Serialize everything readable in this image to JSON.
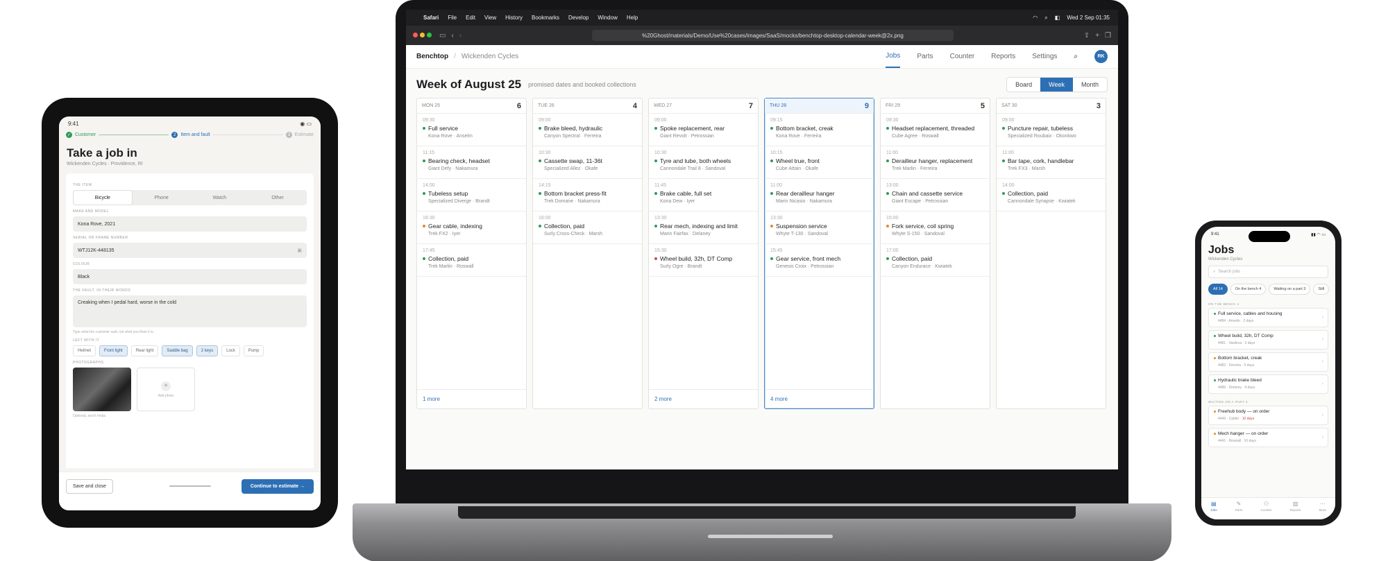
{
  "tablet": {
    "status": {
      "time": "9:41"
    },
    "steps": [
      {
        "label": "Customer",
        "marker": "✓",
        "color": "#2f9a5a"
      },
      {
        "label": "Item and fault",
        "marker": "2",
        "color": "#2d6fb4"
      },
      {
        "label": "Estimate",
        "marker": "3",
        "color": "#bbbbbb"
      }
    ],
    "title": "Take a job in",
    "subtitle": "Wickenden Cycles · Providence, RI",
    "item_label": "THE ITEM",
    "item_types": [
      "Bicycle",
      "Phone",
      "Watch",
      "Other"
    ],
    "make_label": "MAKE AND MODEL",
    "make_value": "Kona Rove, 2021",
    "serial_label": "SERIAL OR FRAME NUMBER",
    "serial_value": "WTJ12K-448135",
    "colour_label": "COLOUR",
    "colour_value": "Black",
    "fault_label": "THE FAULT, IN THEIR WORDS",
    "fault_value": "Creaking when I pedal hard, worse in the cold",
    "fault_hint": "Type what the customer said, not what you think it is.",
    "left_label": "LEFT WITH IT",
    "left_items": [
      {
        "label": "Helmet",
        "on": false
      },
      {
        "label": "Front light",
        "on": true
      },
      {
        "label": "Rear light",
        "on": false
      },
      {
        "label": "Saddle bag",
        "on": true
      },
      {
        "label": "2 keys",
        "on": true
      },
      {
        "label": "Lock",
        "on": false
      },
      {
        "label": "Pump",
        "on": false
      }
    ],
    "photos_label": "PHOTOGRAPHS",
    "add_photo": "Add photo",
    "photos_hint": "Optional, and it helps.",
    "save_button": "Save and close",
    "continue_button": "Continue to estimate →"
  },
  "laptop": {
    "menubar": {
      "app": "Safari",
      "items": [
        "File",
        "Edit",
        "View",
        "History",
        "Bookmarks",
        "Develop",
        "Window",
        "Help"
      ],
      "datetime": "Wed 2 Sep  01:35"
    },
    "url": "%20Ghost/materials/Demo/Use%20cases/images/SaaS/mocks/benchtop-desktop-calendar-week@2x.png",
    "brand": "Benchtop",
    "org": "Wickenden Cycles",
    "nav_tabs": [
      "Jobs",
      "Parts",
      "Counter",
      "Reports",
      "Settings"
    ],
    "active_tab": "Jobs",
    "avatar": "RK",
    "week_title": "Week of August 25",
    "week_sub": "promised dates and booked collections",
    "views": [
      "Board",
      "Week",
      "Month"
    ],
    "active_view": "Week",
    "days": [
      {
        "label": "MON 25",
        "count": "6",
        "today": false,
        "more": "1 more",
        "jobs": [
          {
            "time": "09:30",
            "title": "Full service",
            "meta": "Kona Rove · Anselm",
            "color": "#2f9a5a"
          },
          {
            "time": "11:15",
            "title": "Bearing check, headset",
            "meta": "Giant Defy · Nakamura",
            "color": "#2f9a5a"
          },
          {
            "time": "14:00",
            "title": "Tubeless setup",
            "meta": "Specialized Diverge · Brandt",
            "color": "#2f9a5a"
          },
          {
            "time": "16:30",
            "title": "Gear cable, indexing",
            "meta": "Trek FX2 · Iyer",
            "color": "#e08a2c"
          },
          {
            "time": "17:45",
            "title": "Collection, paid",
            "meta": "Trek Marlin · Roswall",
            "color": "#2f9a5a"
          }
        ]
      },
      {
        "label": "TUE 26",
        "count": "4",
        "today": false,
        "more": "",
        "jobs": [
          {
            "time": "09:00",
            "title": "Brake bleed, hydraulic",
            "meta": "Canyon Spectral · Ferreira",
            "color": "#2f9a5a"
          },
          {
            "time": "10:30",
            "title": "Cassette swap, 11-36t",
            "meta": "Specialized Allez · Okafe",
            "color": "#2f9a5a"
          },
          {
            "time": "14:15",
            "title": "Bottom bracket press-fit",
            "meta": "Trek Domane · Nakamura",
            "color": "#2f9a5a"
          },
          {
            "time": "16:00",
            "title": "Collection, paid",
            "meta": "Surly Cross-Check · Marsh",
            "color": "#2f9a5a"
          }
        ]
      },
      {
        "label": "WED 27",
        "count": "7",
        "today": false,
        "more": "2 more",
        "jobs": [
          {
            "time": "09:00",
            "title": "Spoke replacement, rear",
            "meta": "Giant Revolt · Petrossian",
            "color": "#2f9a5a"
          },
          {
            "time": "10:30",
            "title": "Tyre and tube, both wheels",
            "meta": "Cannondale Trail 8 · Sandoval",
            "color": "#2f9a5a"
          },
          {
            "time": "11:45",
            "title": "Brake cable, full set",
            "meta": "Kona Dew · Iyer",
            "color": "#2f9a5a"
          },
          {
            "time": "13:30",
            "title": "Rear mech, indexing and limit",
            "meta": "Marin Fairfax · Delaney",
            "color": "#2f9a5a"
          },
          {
            "time": "15:30",
            "title": "Wheel build, 32h, DT Comp",
            "meta": "Surly Ogre · Brandt",
            "color": "#c0504d"
          }
        ]
      },
      {
        "label": "THU 28",
        "count": "9",
        "today": true,
        "more": "4 more",
        "jobs": [
          {
            "time": "09:15",
            "title": "Bottom bracket, creak",
            "meta": "Kona Rove · Ferreira",
            "color": "#2f9a5a"
          },
          {
            "time": "10:15",
            "title": "Wheel true, front",
            "meta": "Cube Attain · Okafe",
            "color": "#2f9a5a"
          },
          {
            "time": "11:00",
            "title": "Rear derailleur hanger",
            "meta": "Marin Nicasio · Nakamura",
            "color": "#2f9a5a"
          },
          {
            "time": "13:30",
            "title": "Suspension service",
            "meta": "Whyte T-130 · Sandoval",
            "color": "#e08a2c"
          },
          {
            "time": "15:45",
            "title": "Gear service, front mech",
            "meta": "Genesis Croix · Petrossian",
            "color": "#2f9a5a"
          }
        ]
      },
      {
        "label": "FRI 29",
        "count": "5",
        "today": false,
        "more": "",
        "jobs": [
          {
            "time": "09:30",
            "title": "Headset replacement, threaded",
            "meta": "Cube Agree · Roswall",
            "color": "#2f9a5a"
          },
          {
            "time": "11:00",
            "title": "Derailleur hanger, replacement",
            "meta": "Trek Marlin · Ferreira",
            "color": "#2f9a5a"
          },
          {
            "time": "13:00",
            "title": "Chain and cassette service",
            "meta": "Giant Escape · Petrossian",
            "color": "#2f9a5a"
          },
          {
            "time": "15:00",
            "title": "Fork service, coil spring",
            "meta": "Whyte S-150 · Sandoval",
            "color": "#e08a2c"
          },
          {
            "time": "17:00",
            "title": "Collection, paid",
            "meta": "Canyon Endurace · Kwiatek",
            "color": "#2f9a5a"
          }
        ]
      },
      {
        "label": "SAT 30",
        "count": "3",
        "today": false,
        "more": "",
        "jobs": [
          {
            "time": "09:00",
            "title": "Puncture repair, tubeless",
            "meta": "Specialized Roubaix · Okonkwo",
            "color": "#2f9a5a"
          },
          {
            "time": "11:00",
            "title": "Bar tape, cork, handlebar",
            "meta": "Trek FX3 · Marsh",
            "color": "#2f9a5a"
          },
          {
            "time": "14:00",
            "title": "Collection, paid",
            "meta": "Cannondale Synapse · Kwiatek",
            "color": "#2f9a5a"
          }
        ]
      }
    ]
  },
  "phone": {
    "title": "Jobs",
    "subtitle": "Wickenden Cycles",
    "search_placeholder": "Search jobs",
    "filters": [
      "All 14",
      "On the bench 4",
      "Waiting on a part 3",
      "Still"
    ],
    "sections": [
      {
        "label": "ON THE BENCH 4",
        "items": [
          {
            "name": "Full service, cables and housing",
            "meta": "4484 · Anselm · 2 days",
            "late": "",
            "color": "#2f9a5a"
          },
          {
            "name": "Wheel build, 32h, DT Comp",
            "meta": "4481 · Vasileva · 3 days",
            "late": "",
            "color": "#2f9a5a"
          },
          {
            "name": "Bottom bracket, creak",
            "meta": "4482 · Ferreira · 5 days",
            "late": "",
            "color": "#e08a2c"
          },
          {
            "name": "Hydraulic brake bleed",
            "meta": "4486 · Delaney · 4 days",
            "late": "",
            "color": "#2f9a5a"
          }
        ]
      },
      {
        "label": "WAITING ON A PART 3",
        "items": [
          {
            "name": "Freehub body — on order",
            "meta": "4449 · Calder ·",
            "late": "10 days",
            "color": "#e08a2c"
          },
          {
            "name": "Mech hanger — on order",
            "meta": "4441 · Roswall · 10 days",
            "late": "",
            "color": "#e08a2c"
          }
        ]
      }
    ],
    "tabbar": [
      "Jobs",
      "Parts",
      "Counter",
      "Reports",
      "More"
    ]
  }
}
